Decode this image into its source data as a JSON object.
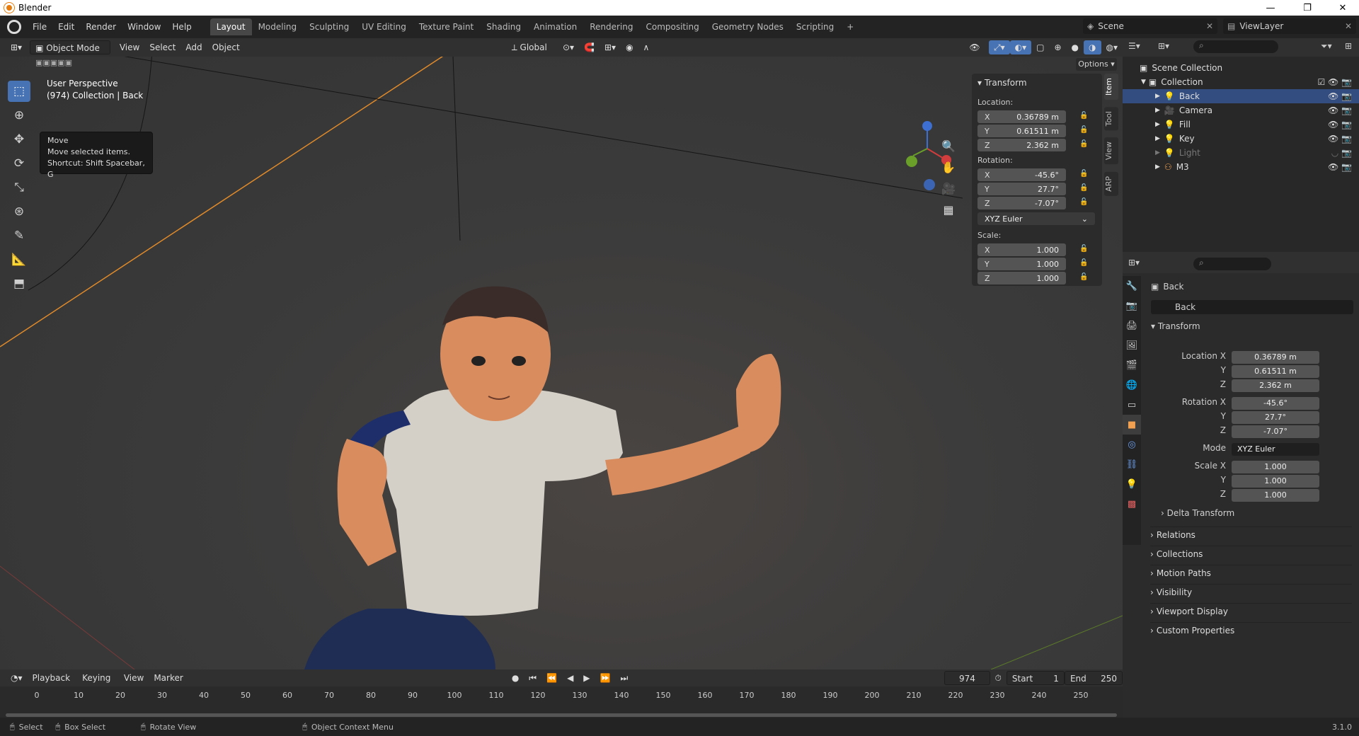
{
  "window": {
    "title": "Blender",
    "min": "—",
    "max": "❐",
    "close": "✕"
  },
  "menus": [
    "File",
    "Edit",
    "Render",
    "Window",
    "Help"
  ],
  "workspaces": [
    "Layout",
    "Modeling",
    "Sculpting",
    "UV Editing",
    "Texture Paint",
    "Shading",
    "Animation",
    "Rendering",
    "Compositing",
    "Geometry Nodes",
    "Scripting",
    "+"
  ],
  "scene": "Scene",
  "view_layer": "ViewLayer",
  "vp_header": {
    "mode": "Object Mode",
    "items": [
      "View",
      "Select",
      "Add",
      "Object"
    ],
    "orientation": "Global",
    "options": "Options"
  },
  "overlay_text": {
    "line1": "User Perspective",
    "line2": "(974) Collection | Back"
  },
  "tooltip": {
    "title": "Move",
    "desc": "Move selected items.",
    "shortcut": "Shortcut: Shift Spacebar, G"
  },
  "npanel": {
    "header": "Transform",
    "loc_label": "Location:",
    "rot_label": "Rotation:",
    "scale_label": "Scale:",
    "loc": [
      {
        "ax": "X",
        "v": "0.36789 m"
      },
      {
        "ax": "Y",
        "v": "0.61511 m"
      },
      {
        "ax": "Z",
        "v": "2.362 m"
      }
    ],
    "rot": [
      {
        "ax": "X",
        "v": "-45.6°"
      },
      {
        "ax": "Y",
        "v": "27.7°"
      },
      {
        "ax": "Z",
        "v": "-7.07°"
      }
    ],
    "mode": "XYZ Euler",
    "scale": [
      {
        "ax": "X",
        "v": "1.000"
      },
      {
        "ax": "Y",
        "v": "1.000"
      },
      {
        "ax": "Z",
        "v": "1.000"
      }
    ]
  },
  "vtabs": [
    "Item",
    "Tool",
    "View",
    "ARP"
  ],
  "outliner": {
    "root": "Scene Collection",
    "collection": "Collection",
    "items": [
      "Back",
      "Camera",
      "Fill",
      "Key",
      "Light",
      "M3"
    ]
  },
  "props": {
    "object": "Back",
    "name_field": "Back",
    "section": "Transform",
    "loc_x_label": "Location X",
    "y": "Y",
    "z": "Z",
    "rot_x_label": "Rotation X",
    "mode_label": "Mode",
    "scale_x_label": "Scale X",
    "loc": [
      "0.36789 m",
      "0.61511 m",
      "2.362 m"
    ],
    "rot": [
      "-45.6°",
      "27.7°",
      "-7.07°"
    ],
    "mode": "XYZ Euler",
    "scale": [
      "1.000",
      "1.000",
      "1.000"
    ],
    "delta": "Delta Transform",
    "sections": [
      "Relations",
      "Collections",
      "Motion Paths",
      "Visibility",
      "Viewport Display",
      "Custom Properties"
    ]
  },
  "timeline": {
    "menus": [
      "Playback",
      "Keying",
      "View",
      "Marker"
    ],
    "frame": "974",
    "start_label": "Start",
    "start": "1",
    "end_label": "End",
    "end": "250",
    "ticks": [
      "0",
      "10",
      "20",
      "30",
      "40",
      "50",
      "60",
      "70",
      "80",
      "90",
      "100",
      "110",
      "120",
      "130",
      "140",
      "150",
      "160",
      "170",
      "180",
      "190",
      "200",
      "210",
      "220",
      "230",
      "240",
      "250"
    ]
  },
  "status": {
    "select": "Select",
    "box": "Box Select",
    "rotate": "Rotate View",
    "ctx": "Object Context Menu",
    "version": "3.1.0"
  }
}
